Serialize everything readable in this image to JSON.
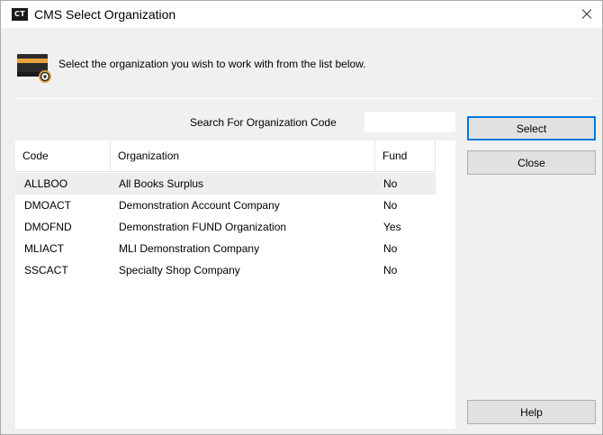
{
  "window": {
    "logo_text": "CT",
    "title": "CMS Select Organization",
    "close_icon": "close-icon"
  },
  "header": {
    "icon": "organization-settings-icon",
    "instruction": "Select the organization you wish to work with from the list below."
  },
  "search": {
    "label": "Search For Organization Code",
    "value": ""
  },
  "list": {
    "columns": [
      "Code",
      "Organization",
      "Fund"
    ],
    "rows": [
      {
        "code": "ALLBOO",
        "organization": "All Books Surplus",
        "fund": "No",
        "selected": true
      },
      {
        "code": "DMOACT",
        "organization": "Demonstration Account Company",
        "fund": "No"
      },
      {
        "code": "DMOFND",
        "organization": "Demonstration FUND Organization",
        "fund": "Yes"
      },
      {
        "code": "MLIACT",
        "organization": "MLI Demonstration Company",
        "fund": "No"
      },
      {
        "code": "SSCACT",
        "organization": "Specialty Shop Company",
        "fund": "No"
      }
    ]
  },
  "buttons": {
    "select": "Select",
    "close": "Close",
    "help": "Help"
  },
  "colors": {
    "accent": "#0078d7",
    "dialog_bg": "#f0f0f0",
    "selected_row": "#eeeeee",
    "icon_orange": "#f0a030"
  }
}
